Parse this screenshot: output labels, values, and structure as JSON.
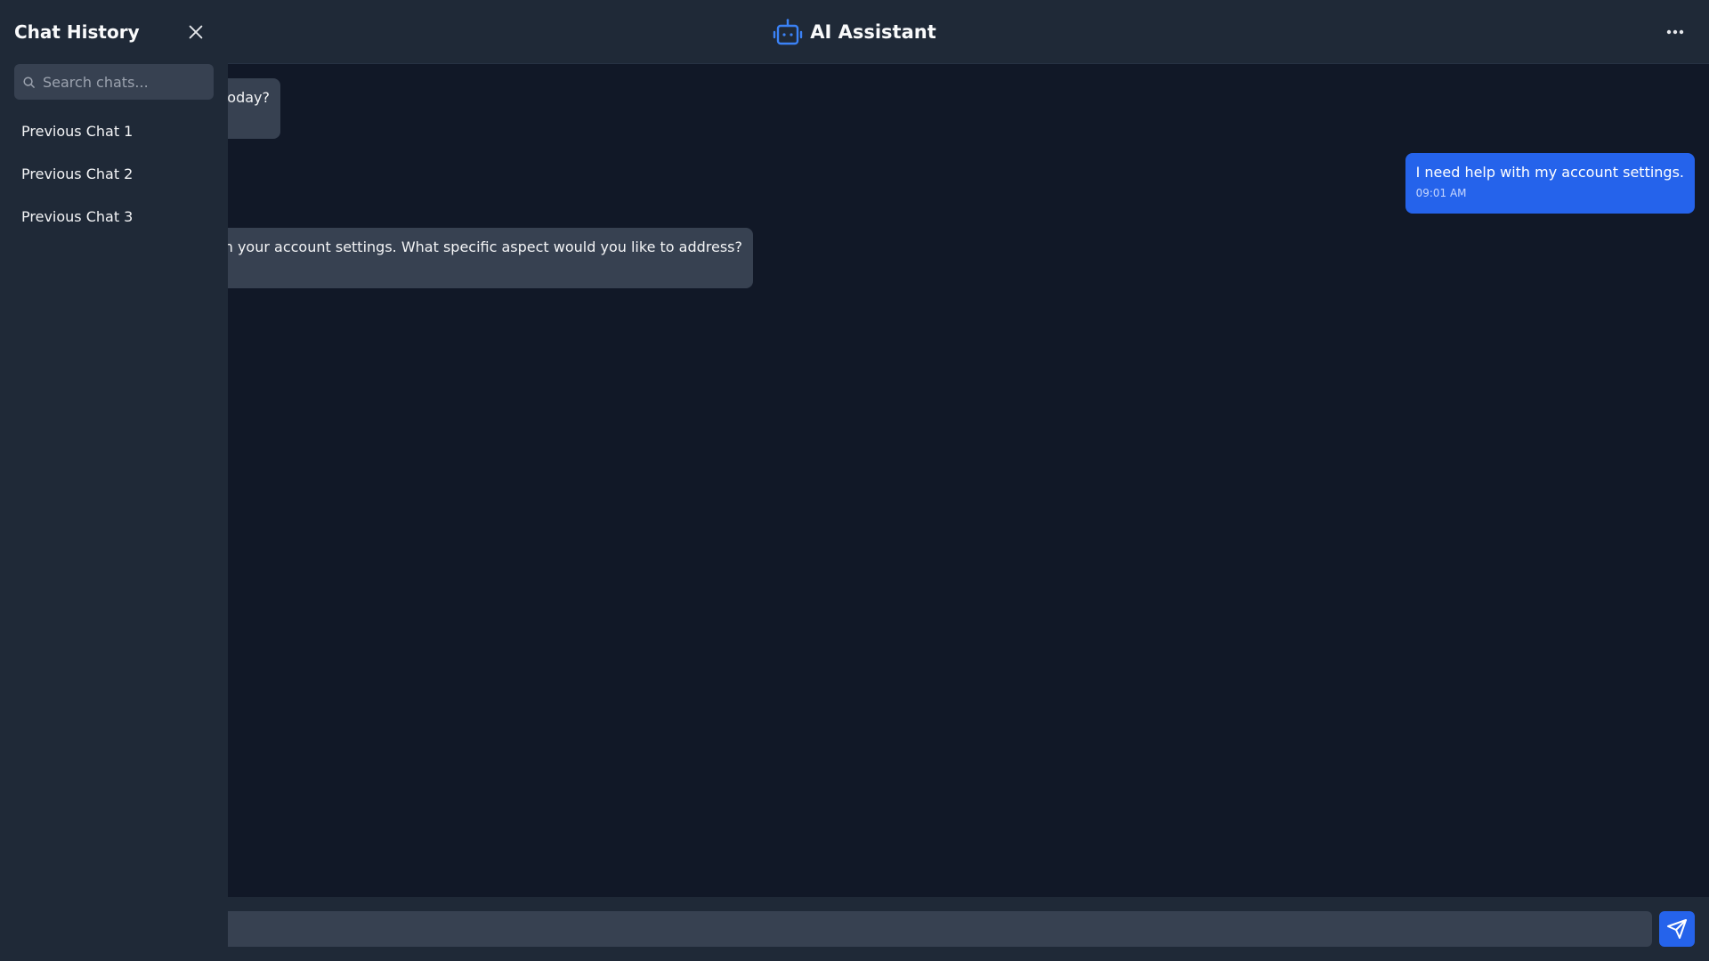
{
  "header": {
    "title": "AI Assistant",
    "brand_icon": "robot-icon",
    "menu_icon": "more-horizontal-icon",
    "accent_color": "#3b82f6"
  },
  "sidebar": {
    "title": "Chat History",
    "close_icon": "close-icon",
    "search": {
      "placeholder": "Search chats...",
      "value": ""
    },
    "items": [
      {
        "label": "Previous Chat 1"
      },
      {
        "label": "Previous Chat 2"
      },
      {
        "label": "Previous Chat 3"
      }
    ]
  },
  "messages": [
    {
      "role": "assistant",
      "text": "oday?",
      "time": ""
    },
    {
      "role": "user",
      "text": "I need help with my account settings.",
      "time": "09:01 AM"
    },
    {
      "role": "assistant",
      "text": "n your account settings. What specific aspect would you like to address?",
      "time": ""
    }
  ],
  "composer": {
    "placeholder": "",
    "value": "",
    "send_icon": "send-icon"
  },
  "colors": {
    "background": "#111827",
    "panel": "#1f2937",
    "assistant_bubble": "#374151",
    "user_bubble": "#2563eb"
  }
}
